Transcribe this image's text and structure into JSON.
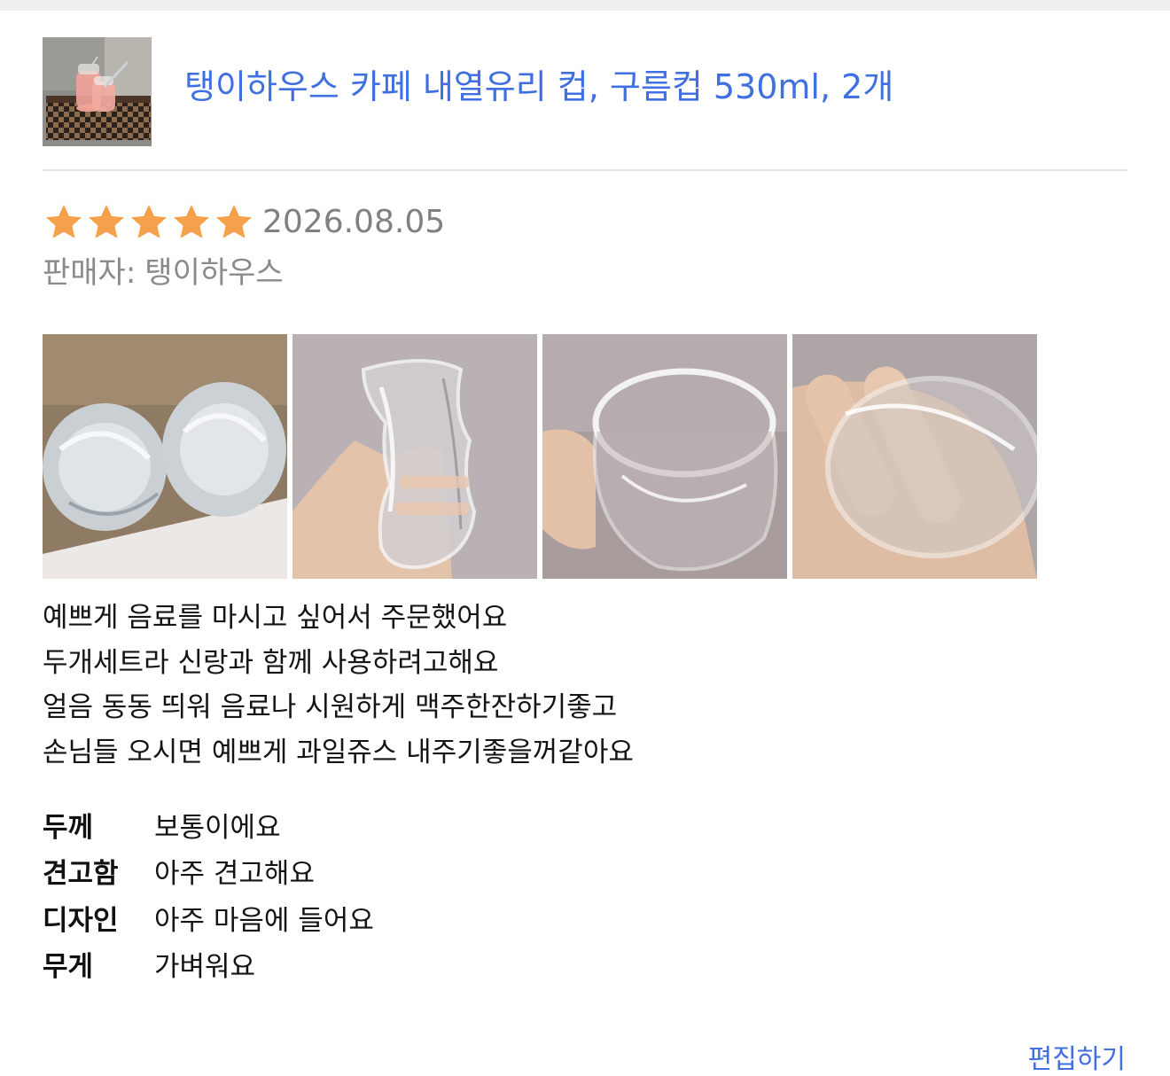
{
  "product": {
    "title": "탱이하우스 카페 내열유리 컵, 구름컵 530ml, 2개",
    "thumbnail_icon": "product-thumbnail"
  },
  "review": {
    "rating": 5,
    "rating_max": 5,
    "star_color": "#f5a04a",
    "date": "2026.08.05",
    "seller_label": "판매자:",
    "seller_name": "탱이하우스",
    "photos": [
      {
        "name": "photo-packaging"
      },
      {
        "name": "photo-cup-in-hand"
      },
      {
        "name": "photo-cup-rim"
      },
      {
        "name": "photo-cup-bottom"
      }
    ],
    "text_lines": [
      "예쁘게 음료를 마시고 싶어서 주문했어요",
      "두개세트라 신랑과 함께 사용하려고해요",
      "얼음 동동 띄워 음료나 시원하게 맥주한잔하기좋고",
      "손님들 오시면 예쁘게 과일쥬스 내주기좋을꺼같아요"
    ],
    "attributes": [
      {
        "label": "두께",
        "value": "보통이에요"
      },
      {
        "label": "견고함",
        "value": "아주 견고해요"
      },
      {
        "label": "디자인",
        "value": "아주 마음에 들어요"
      },
      {
        "label": "무게",
        "value": "가벼워요"
      }
    ]
  },
  "actions": {
    "edit_label": "편집하기"
  },
  "colors": {
    "accent": "#3f6fe0",
    "muted_text": "#808080",
    "divider": "#e4e4e4"
  }
}
